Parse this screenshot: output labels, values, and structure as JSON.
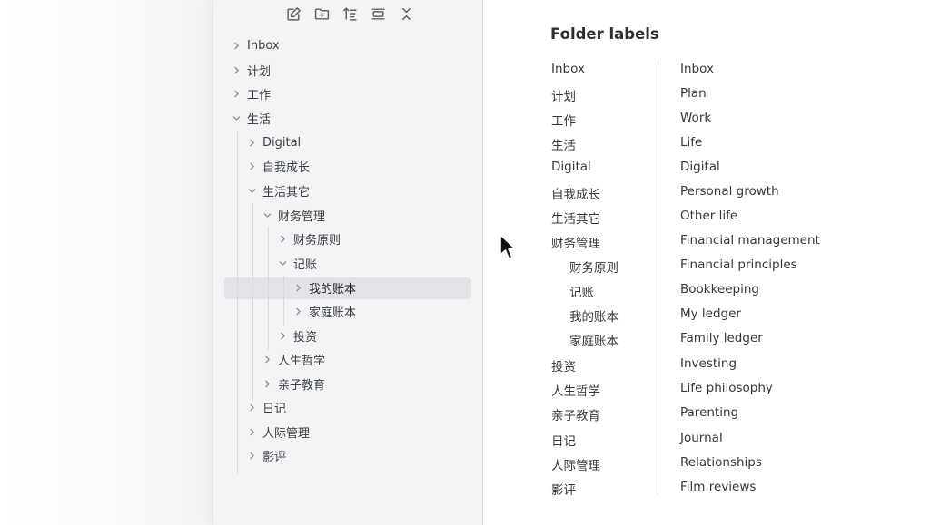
{
  "toolbar": {
    "icons": [
      "new-note-icon",
      "new-folder-icon",
      "sort-icon",
      "collapse-panel-icon",
      "collapse-all-icon"
    ]
  },
  "tree": {
    "items": [
      {
        "label": "Inbox",
        "expanded": false
      },
      {
        "label": "计划",
        "expanded": false
      },
      {
        "label": "工作",
        "expanded": false
      },
      {
        "label": "生活",
        "expanded": true
      },
      {
        "label": "Digital",
        "expanded": false
      },
      {
        "label": "自我成长",
        "expanded": false
      },
      {
        "label": "生活其它",
        "expanded": true
      },
      {
        "label": "财务管理",
        "expanded": true
      },
      {
        "label": "财务原则",
        "expanded": false
      },
      {
        "label": "记账",
        "expanded": true
      },
      {
        "label": "我的账本",
        "expanded": false,
        "selected": true
      },
      {
        "label": "家庭账本",
        "expanded": false
      },
      {
        "label": "投资",
        "expanded": false
      },
      {
        "label": "人生哲学",
        "expanded": false
      },
      {
        "label": "亲子教育",
        "expanded": false
      },
      {
        "label": "日记",
        "expanded": false
      },
      {
        "label": "人际管理",
        "expanded": false
      },
      {
        "label": "影评",
        "expanded": false
      }
    ]
  },
  "labels_panel": {
    "title": "Folder labels",
    "rows": [
      {
        "zh": "Inbox",
        "en": "Inbox"
      },
      {
        "zh": "计划",
        "en": "Plan"
      },
      {
        "zh": "工作",
        "en": "Work"
      },
      {
        "zh": "生活",
        "en": "Life"
      },
      {
        "zh": "Digital",
        "en": "Digital"
      },
      {
        "zh": "自我成长",
        "en": "Personal growth"
      },
      {
        "zh": "生活其它",
        "en": "Other life"
      },
      {
        "zh": "财务管理",
        "en": "Financial management"
      },
      {
        "zh": "财务原则",
        "en": "Financial principles"
      },
      {
        "zh": "记账",
        "en": "Bookkeeping"
      },
      {
        "zh": "我的账本",
        "en": "My ledger"
      },
      {
        "zh": "家庭账本",
        "en": "Family ledger"
      },
      {
        "zh": "投资",
        "en": "Investing"
      },
      {
        "zh": "人生哲学",
        "en": "Life philosophy"
      },
      {
        "zh": "亲子教育",
        "en": "Parenting"
      },
      {
        "zh": "日记",
        "en": "Journal"
      },
      {
        "zh": "人际管理",
        "en": "Relationships"
      },
      {
        "zh": "影评",
        "en": "Film reviews"
      }
    ]
  },
  "colors": {
    "sidebar_bg": "#f3f4f6",
    "selected_bg": "#e2e3e6",
    "text": "#3a3d42"
  }
}
